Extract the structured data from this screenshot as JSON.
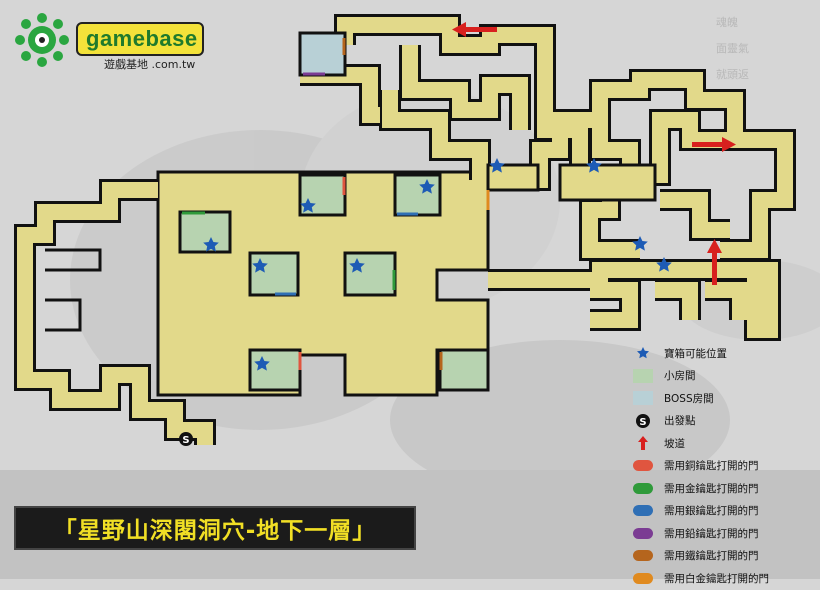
{
  "logo": {
    "brand": "gamebase",
    "sub": "遊戲基地 .com.tw"
  },
  "side_marks": [
    "魂魄",
    "面靈氣",
    "就頭返"
  ],
  "title": "「星野山深閣洞穴-地下一層」",
  "start_marker": "S",
  "legend": [
    {
      "icon": "star-icon",
      "label": "寶箱可能位置",
      "color": "#1d5bb5"
    },
    {
      "icon": "small-room-swatch",
      "label": "小房間",
      "color": "#b7d3b0"
    },
    {
      "icon": "boss-room-swatch",
      "label": "BOSS房間",
      "color": "#b8d0d6"
    },
    {
      "icon": "start-icon",
      "label": "出發點",
      "color": "#000000"
    },
    {
      "icon": "ramp-arrow-icon",
      "label": "坡道",
      "color": "#d8201e"
    },
    {
      "icon": "door-dot-icon",
      "label": "需用銅鑰匙打開的門",
      "color": "#e0553f"
    },
    {
      "icon": "door-dot-icon",
      "label": "需用金鑰匙打開的門",
      "color": "#2f9a3a"
    },
    {
      "icon": "door-dot-icon",
      "label": "需用銀鑰匙打開的門",
      "color": "#2f6fb5"
    },
    {
      "icon": "door-dot-icon",
      "label": "需用鉛鑰匙打開的門",
      "color": "#7b3c93"
    },
    {
      "icon": "door-dot-icon",
      "label": "需用鐵鑰匙打開的門",
      "color": "#b5651d"
    },
    {
      "icon": "door-dot-icon",
      "label": "需用白金鑰匙打開的門",
      "color": "#e08a1f"
    }
  ]
}
